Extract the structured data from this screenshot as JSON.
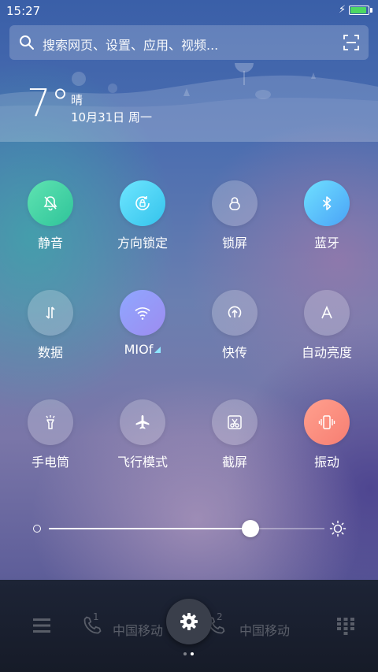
{
  "status": {
    "time": "15:27",
    "battery_level": 0.9
  },
  "search": {
    "placeholder": "搜索网页、设置、应用、视频..."
  },
  "weather": {
    "temp": "7°",
    "condition": "晴",
    "date": "10月31日 周一"
  },
  "tiles": [
    {
      "label": "静音",
      "icon": "bell-off-icon",
      "active": true,
      "color": "#3fd0a6"
    },
    {
      "label": "方向锁定",
      "icon": "rotation-lock-icon",
      "active": true,
      "color": "#4fd3f5"
    },
    {
      "label": "锁屏",
      "icon": "lock-icon",
      "active": false
    },
    {
      "label": "蓝牙",
      "icon": "bluetooth-icon",
      "active": true,
      "color": "#5ab8f9"
    },
    {
      "label": "数据",
      "icon": "mobile-data-icon",
      "active": false
    },
    {
      "label": "MIOf",
      "icon": "wifi-icon",
      "active": true,
      "color": "#9a9cf5"
    },
    {
      "label": "快传",
      "icon": "transfer-icon",
      "active": false
    },
    {
      "label": "自动亮度",
      "icon": "auto-brightness-icon",
      "active": false
    },
    {
      "label": "手电筒",
      "icon": "flashlight-icon",
      "active": false
    },
    {
      "label": "飞行模式",
      "icon": "airplane-icon",
      "active": false
    },
    {
      "label": "截屏",
      "icon": "screenshot-icon",
      "active": false
    },
    {
      "label": "振动",
      "icon": "vibrate-icon",
      "active": true,
      "color": "#f98a7c"
    }
  ],
  "brightness": {
    "value": 0.73
  },
  "dock": {
    "sim1_label": "中国移动",
    "sim2_label": "中国移动",
    "sim1_index": "1",
    "sim2_index": "2"
  }
}
